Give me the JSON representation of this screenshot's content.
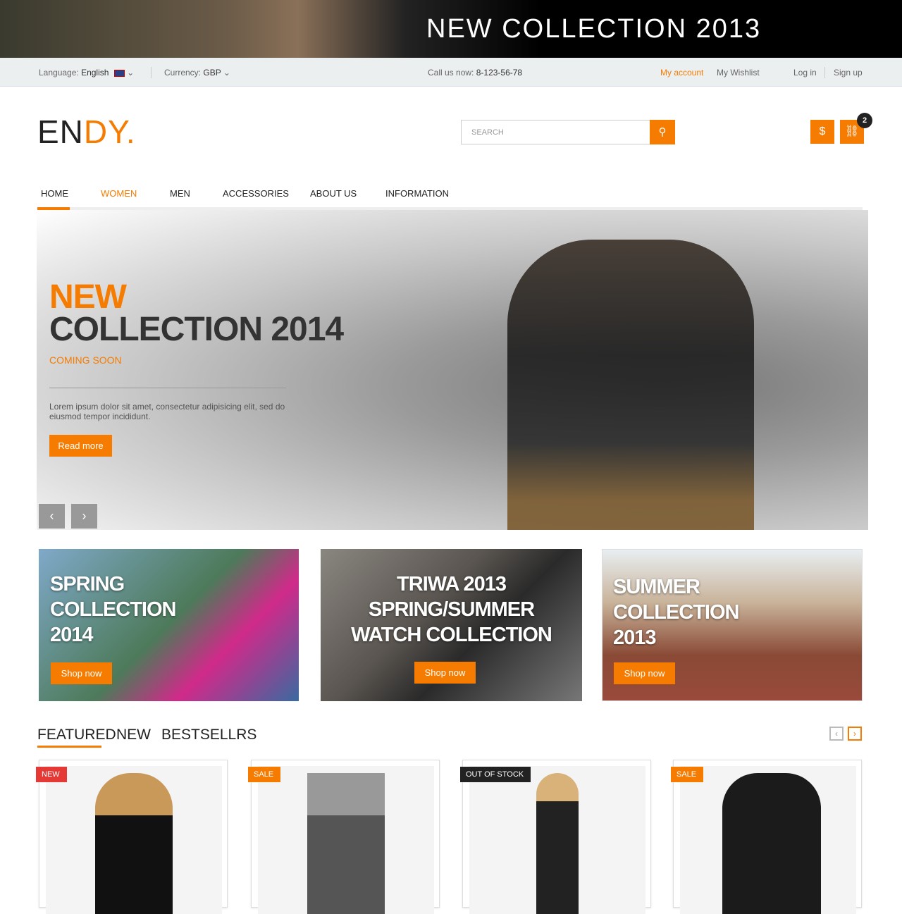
{
  "banner": {
    "title": "NEW COLLECTION 2013"
  },
  "topbar": {
    "language_label": "Language:",
    "language": "English",
    "currency_label": "Currency:",
    "currency": "GBP",
    "call_label": "Call us now:",
    "phone": "8-123-56-78",
    "my_account": "My account",
    "wishlist": "My Wishlist",
    "login": "Log in",
    "signup": "Sign up"
  },
  "header": {
    "logo_a": "EN",
    "logo_b": "DY.",
    "search_placeholder": "SEARCH",
    "cart_count": "2"
  },
  "nav": [
    "HOME",
    "WOMEN",
    "MEN",
    "ACCESSORIES",
    "ABOUT US",
    "INFORMATION"
  ],
  "hero": {
    "title_a": "NEW",
    "title_b": "COLLECTION 2014",
    "subtitle": "COMING SOON",
    "text": "Lorem ipsum dolor sit amet, consectetur adipisicing elit, sed do eiusmod tempor incididunt.",
    "button": "Read more"
  },
  "promos": [
    {
      "title": "SPRING COLLECTION 2014",
      "button": "Shop now"
    },
    {
      "title": "TRIWA 2013 SPRING/SUMMER WATCH COLLECTION",
      "button": "Shop now"
    },
    {
      "title": "SUMMER COLLECTION 2013",
      "button": "Shop now"
    }
  ],
  "tabs": [
    "FEATURED",
    "NEW",
    "BESTSELLRS"
  ],
  "products": [
    {
      "label": "NEW",
      "color": "#e53935"
    },
    {
      "label": "SALE",
      "color": "#f57c00"
    },
    {
      "label": "OUT OF STOCK",
      "color": "#222222"
    },
    {
      "label": "SALE",
      "color": "#f57c00"
    }
  ],
  "colors": {
    "accent": "#f57c00"
  }
}
